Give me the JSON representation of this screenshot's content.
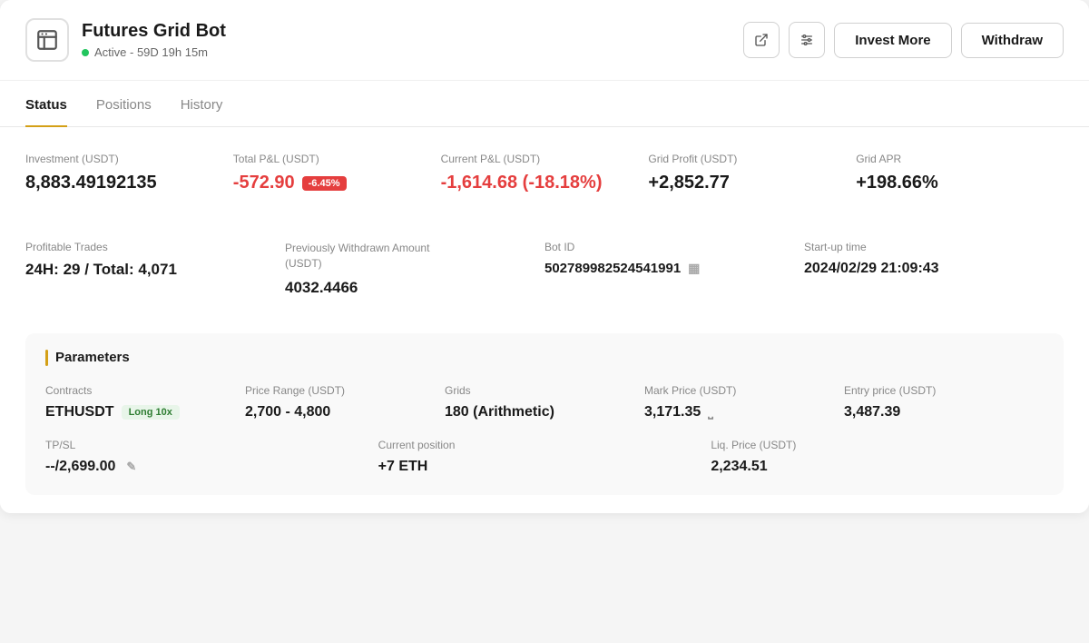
{
  "header": {
    "title": "Futures Grid Bot",
    "status": "Active - 59D 19h 15m",
    "status_color": "#22c55e",
    "actions": {
      "external_link_label": "↗",
      "settings_label": "⚙",
      "invest_more_label": "Invest More",
      "withdraw_label": "Withdraw"
    }
  },
  "tabs": [
    {
      "id": "status",
      "label": "Status",
      "active": true
    },
    {
      "id": "positions",
      "label": "Positions",
      "active": false
    },
    {
      "id": "history",
      "label": "History",
      "active": false
    }
  ],
  "stats_row1": [
    {
      "label": "Investment (USDT)",
      "value": "8,883.49192135",
      "color": "normal",
      "badge": null
    },
    {
      "label": "Total P&L (USDT)",
      "value": "-572.90",
      "color": "negative",
      "badge": "-6.45%"
    },
    {
      "label": "Current P&L (USDT)",
      "value": "-1,614.68 (-18.18%)",
      "color": "negative",
      "badge": null
    },
    {
      "label": "Grid Profit (USDT)",
      "value": "+2,852.77",
      "color": "normal",
      "badge": null
    },
    {
      "label": "Grid APR",
      "value": "+198.66%",
      "color": "normal",
      "badge": null
    }
  ],
  "stats_row2": [
    {
      "label": "Profitable Trades",
      "value": "24H: 29 / Total: 4,071"
    },
    {
      "label": "Previously Withdrawn Amount (USDT)",
      "value": "4032.4466"
    },
    {
      "label": "Bot ID",
      "value": "502789982524541991",
      "copyable": true
    },
    {
      "label": "Start-up time",
      "value": "2024/02/29 21:09:43"
    }
  ],
  "parameters": {
    "section_title": "Parameters",
    "row1": [
      {
        "label": "Contracts",
        "value": "ETHUSDT",
        "tag": "Long 10x"
      },
      {
        "label": "Price Range (USDT)",
        "value": "2,700 - 4,800"
      },
      {
        "label": "Grids",
        "value": "180 (Arithmetic)"
      },
      {
        "label": "Mark Price (USDT)",
        "value": "3,171.35",
        "mark_icon": true
      },
      {
        "label": "Entry price (USDT)",
        "value": "3,487.39"
      }
    ],
    "row2": [
      {
        "label": "TP/SL",
        "value": "--/2,699.00",
        "editable": true
      },
      {
        "label": "Current position",
        "value": "+7 ETH"
      },
      {
        "label": "Liq. Price (USDT)",
        "value": "2,234.51"
      }
    ]
  }
}
